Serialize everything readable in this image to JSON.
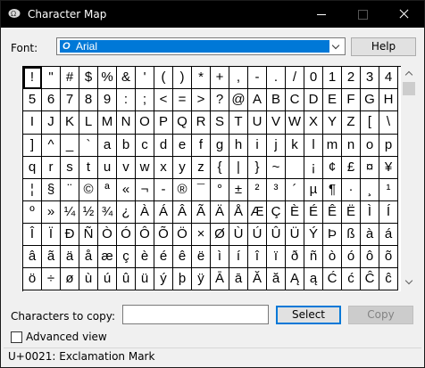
{
  "window": {
    "title": "Character Map",
    "icon": "character-map-app-icon"
  },
  "font": {
    "label": "Font:",
    "selected": "Arial",
    "font_icon": "opentype-font-icon"
  },
  "buttons": {
    "help": "Help",
    "select": "Select",
    "copy": "Copy"
  },
  "grid": {
    "selected_index": 0,
    "chars": [
      "!",
      "\"",
      "#",
      "$",
      "%",
      "&",
      "'",
      "(",
      ")",
      "*",
      "+",
      ",",
      "-",
      ".",
      "/",
      "0",
      "1",
      "2",
      "3",
      "4",
      "5",
      "6",
      "7",
      "8",
      "9",
      ":",
      ";",
      "<",
      "=",
      ">",
      "?",
      "@",
      "A",
      "B",
      "C",
      "D",
      "E",
      "F",
      "G",
      "H",
      "I",
      "J",
      "K",
      "L",
      "M",
      "N",
      "O",
      "P",
      "Q",
      "R",
      "S",
      "T",
      "U",
      "V",
      "W",
      "X",
      "Y",
      "Z",
      "[",
      "\\",
      "]",
      "^",
      "_",
      "`",
      "a",
      "b",
      "c",
      "d",
      "e",
      "f",
      "g",
      "h",
      "i",
      "j",
      "k",
      "l",
      "m",
      "n",
      "o",
      "p",
      "q",
      "r",
      "s",
      "t",
      "u",
      "v",
      "w",
      "x",
      "y",
      "z",
      "{",
      "|",
      "}",
      "~",
      "",
      "¡",
      "¢",
      "£",
      "¤",
      "¥",
      "¦",
      "§",
      "¨",
      "©",
      "ª",
      "«",
      "¬",
      "-",
      "®",
      "¯",
      "°",
      "±",
      "²",
      "³",
      "´",
      "µ",
      "¶",
      "·",
      "¸",
      "¹",
      "º",
      "»",
      "¼",
      "½",
      "¾",
      "¿",
      "À",
      "Á",
      "Â",
      "Ã",
      "Ä",
      "Å",
      "Æ",
      "Ç",
      "È",
      "É",
      "Ê",
      "Ë",
      "Ì",
      "Í",
      "Î",
      "Ï",
      "Ð",
      "Ñ",
      "Ò",
      "Ó",
      "Ô",
      "Õ",
      "Ö",
      "×",
      "Ø",
      "Ù",
      "Ú",
      "Û",
      "Ü",
      "Ý",
      "Þ",
      "ß",
      "à",
      "á",
      "â",
      "ã",
      "ä",
      "å",
      "æ",
      "ç",
      "è",
      "é",
      "ê",
      "ë",
      "ì",
      "í",
      "î",
      "ï",
      "ð",
      "ñ",
      "ò",
      "ó",
      "ô",
      "õ",
      "ö",
      "÷",
      "ø",
      "ù",
      "ú",
      "û",
      "ü",
      "ý",
      "þ",
      "ÿ",
      "Ā",
      "ā",
      "Ă",
      "ă",
      "Ą",
      "ą",
      "Ć",
      "ć",
      "Ĉ",
      "ĉ"
    ]
  },
  "copy": {
    "label": "Characters to copy:",
    "value": ""
  },
  "advanced": {
    "label": "Advanced view",
    "checked": false
  },
  "status": {
    "text": "U+0021: Exclamation Mark"
  }
}
